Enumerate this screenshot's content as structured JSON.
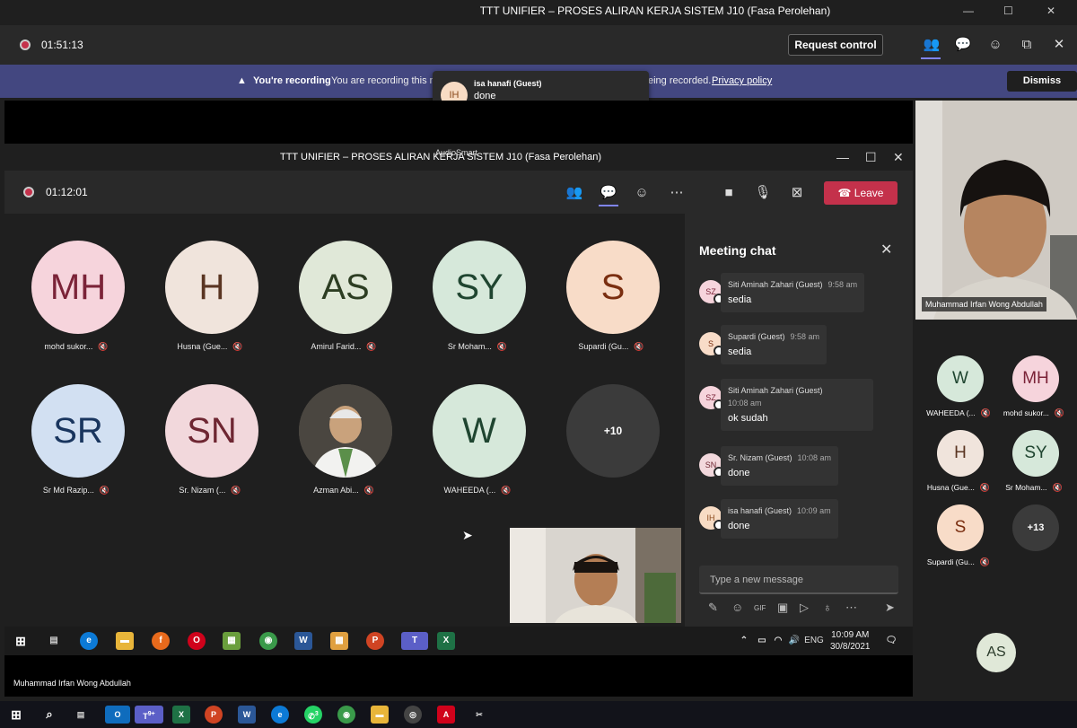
{
  "outer": {
    "title": "TTT UNIFIER – PROSES ALIRAN KERJA SISTEM J10 (Fasa Perolehan)",
    "timer": "01:51:13",
    "request_control": "Request control"
  },
  "banner": {
    "title": "You're recording",
    "text1": "You are recording this m",
    "text2": "eing recorded.",
    "privacy": "Privacy policy",
    "dismiss": "Dismiss"
  },
  "toast": {
    "initials": "IH",
    "name": "isa hanafi (Guest)",
    "message": "done"
  },
  "inner": {
    "title": "TTT UNIFIER – PROSES ALIRAN KERJA SISTEM J10 (Fasa Perolehan)",
    "overlay": "AudioSmart",
    "timer": "01:12:01",
    "leave": "Leave"
  },
  "tiles": [
    {
      "initials": "MH",
      "name": "mohd sukor...",
      "bg": "#f6d4dc",
      "fg": "#7b2338"
    },
    {
      "initials": "H",
      "name": "Husna (Gue...",
      "bg": "#f0e4dc",
      "fg": "#5a3522"
    },
    {
      "initials": "AS",
      "name": "Amirul Farid...",
      "bg": "#e0e8d8",
      "fg": "#2c3d22"
    },
    {
      "initials": "SY",
      "name": "Sr Moham...",
      "bg": "#d6e8da",
      "fg": "#1f4530"
    },
    {
      "initials": "S",
      "name": "Supardi (Gu...",
      "bg": "#f8dcc8",
      "fg": "#7a2e10"
    },
    {
      "initials": "SR",
      "name": "Sr Md Razip...",
      "bg": "#d2e0f2",
      "fg": "#19355e"
    },
    {
      "initials": "SN",
      "name": "Sr. Nizam (...",
      "bg": "#f2d8dc",
      "fg": "#6e2632"
    },
    {
      "initials": "",
      "name": "Azman Abi...",
      "bg": "#7a7368",
      "fg": "#fff"
    },
    {
      "initials": "W",
      "name": "WAHEEDA (...",
      "bg": "#d6e8da",
      "fg": "#1f4530"
    },
    {
      "initials": "+10",
      "name": "",
      "bg": "#3b3b3b",
      "fg": "#fff"
    }
  ],
  "chat": {
    "title": "Meeting chat",
    "messages": [
      {
        "initials": "SZ",
        "name": "Siti Aminah Zahari (Guest)",
        "time": "9:58 am",
        "text": "sedia"
      },
      {
        "initials": "S",
        "name": "Supardi (Guest)",
        "time": "9:58 am",
        "text": "sedia"
      },
      {
        "initials": "SZ",
        "name": "Siti Aminah Zahari (Guest)",
        "time": "10:08 am",
        "text": "ok sudah"
      },
      {
        "initials": "SN",
        "name": "Sr. Nizam (Guest)",
        "time": "10:08 am",
        "text": "done"
      },
      {
        "initials": "IH",
        "name": "isa hanafi (Guest)",
        "time": "10:09 am",
        "text": "done"
      }
    ],
    "placeholder": "Type a new message"
  },
  "taskbar": {
    "lang": "ENG",
    "time": "10:09 AM",
    "date": "30/8/2021"
  },
  "presenter": {
    "name": "Muhammad Irfan Wong Abdullah"
  },
  "right_video": {
    "name": "Muhammad Irfan Wong Abdullah"
  },
  "right_tiles": [
    {
      "initials": "W",
      "name": "WAHEEDA (...",
      "bg": "#d6e8da",
      "fg": "#1f4530"
    },
    {
      "initials": "MH",
      "name": "mohd sukor...",
      "bg": "#f6d4dc",
      "fg": "#7b2338"
    },
    {
      "initials": "H",
      "name": "Husna (Gue...",
      "bg": "#f0e4dc",
      "fg": "#5a3522"
    },
    {
      "initials": "SY",
      "name": "Sr Moham...",
      "bg": "#d6e8da",
      "fg": "#1f4530"
    },
    {
      "initials": "S",
      "name": "Supardi (Gu...",
      "bg": "#f8dcc8",
      "fg": "#7a2e10"
    },
    {
      "initials": "+13",
      "name": "",
      "bg": "#3b3b3b",
      "fg": "#fff"
    }
  ],
  "bottom_tile": {
    "initials": "AS"
  },
  "win_taskbar_badges": {
    "teams": "9+",
    "whatsapp": "3"
  }
}
